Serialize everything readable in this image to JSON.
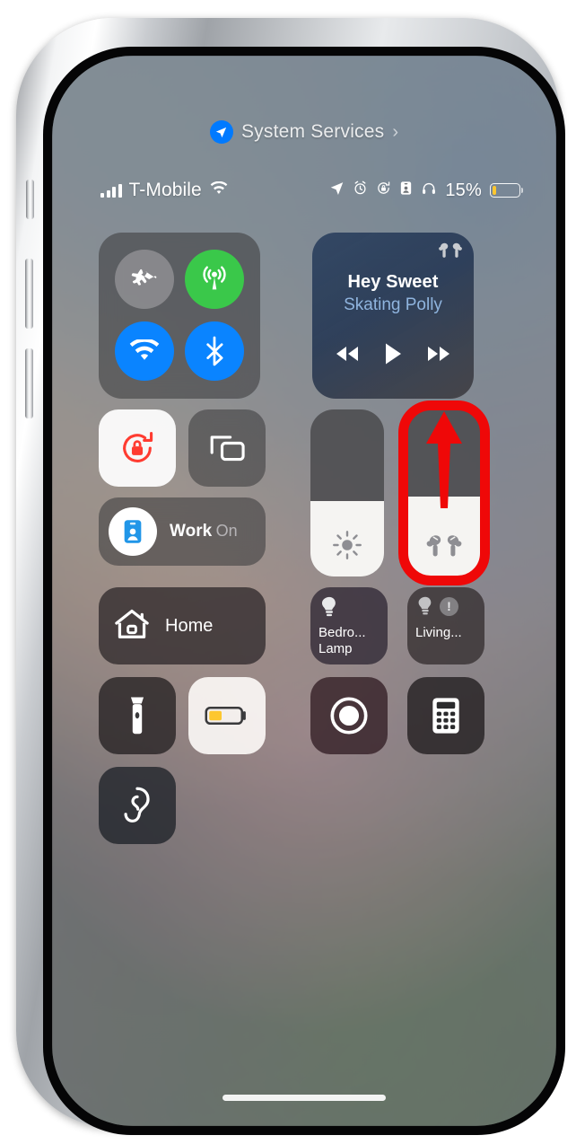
{
  "device": {
    "name": "iphone-x"
  },
  "header": {
    "location_icon": "location-arrow-icon",
    "title": "System Services",
    "chevron": "›"
  },
  "statusbar": {
    "carrier": "T-Mobile",
    "signal_icon": "cellular-bars-icon",
    "wifi_icon": "wifi-icon",
    "right_icons": [
      "location-arrow-icon",
      "alarm-clock-icon",
      "rotation-lock-icon",
      "focus-work-icon",
      "headphones-icon"
    ],
    "battery_percent": "15%",
    "battery_level": 15,
    "battery_color": "#fdc72f"
  },
  "connectivity": {
    "airplane": {
      "name": "Airplane Mode",
      "state": "off",
      "color": "#8c8c8f",
      "icon": "airplane-icon"
    },
    "cellular": {
      "name": "Cellular Data",
      "state": "on",
      "color": "#3ac84a",
      "icon": "cellular-antenna-icon"
    },
    "wifi": {
      "name": "Wi-Fi",
      "state": "on",
      "color": "#0a84ff",
      "icon": "wifi-icon"
    },
    "bluetooth": {
      "name": "Bluetooth",
      "state": "on",
      "color": "#0a84ff",
      "icon": "bluetooth-icon"
    }
  },
  "now_playing": {
    "title": "Hey Sweet",
    "artist": "Skating Polly",
    "route_icon": "airpods-icon",
    "title_color": "#ffffff",
    "artist_color": "#8fb4de",
    "controls": [
      "rewind-icon",
      "play-icon",
      "fast-forward-icon"
    ]
  },
  "toggles": {
    "rotation_lock": {
      "name": "Rotation Lock",
      "state": "on",
      "icon": "rotation-lock-icon",
      "accent": "#ff3b30"
    },
    "screen_mirroring": {
      "name": "Screen Mirroring",
      "state": "off",
      "icon": "screen-mirroring-icon"
    }
  },
  "focus": {
    "name": "Work",
    "state": "On",
    "icon": "work-badge-icon"
  },
  "sliders": {
    "brightness": {
      "name": "Brightness",
      "icon": "brightness-icon",
      "level": 45
    },
    "volume": {
      "name": "Volume",
      "icon": "airpods-pro-icon",
      "level": 48
    }
  },
  "annotation": {
    "color": "#ef0808",
    "shape": "rounded-rect-with-up-arrow",
    "target": "volume-slider"
  },
  "home": {
    "home_button": {
      "label": "Home",
      "icon": "home-icon"
    },
    "accessories": [
      {
        "label_line1": "Bedro...",
        "label_line2": "Lamp",
        "icon": "lightbulb-icon",
        "has_warning": false
      },
      {
        "label_line1": "Living...",
        "label_line2": "",
        "icon": "lightbulb-icon",
        "has_warning": true,
        "warning_glyph": "!"
      }
    ]
  },
  "utilities": [
    {
      "name": "Flashlight",
      "icon": "flashlight-icon",
      "state": "off"
    },
    {
      "name": "Low Power Mode",
      "icon": "battery-low-power-icon",
      "state": "on",
      "accent": "#fdc72f"
    },
    {
      "name": "Screen Recording",
      "icon": "screen-record-icon",
      "state": "off"
    },
    {
      "name": "Calculator",
      "icon": "calculator-icon",
      "state": "off"
    },
    {
      "name": "Hearing",
      "icon": "ear-icon",
      "state": "off"
    }
  ]
}
